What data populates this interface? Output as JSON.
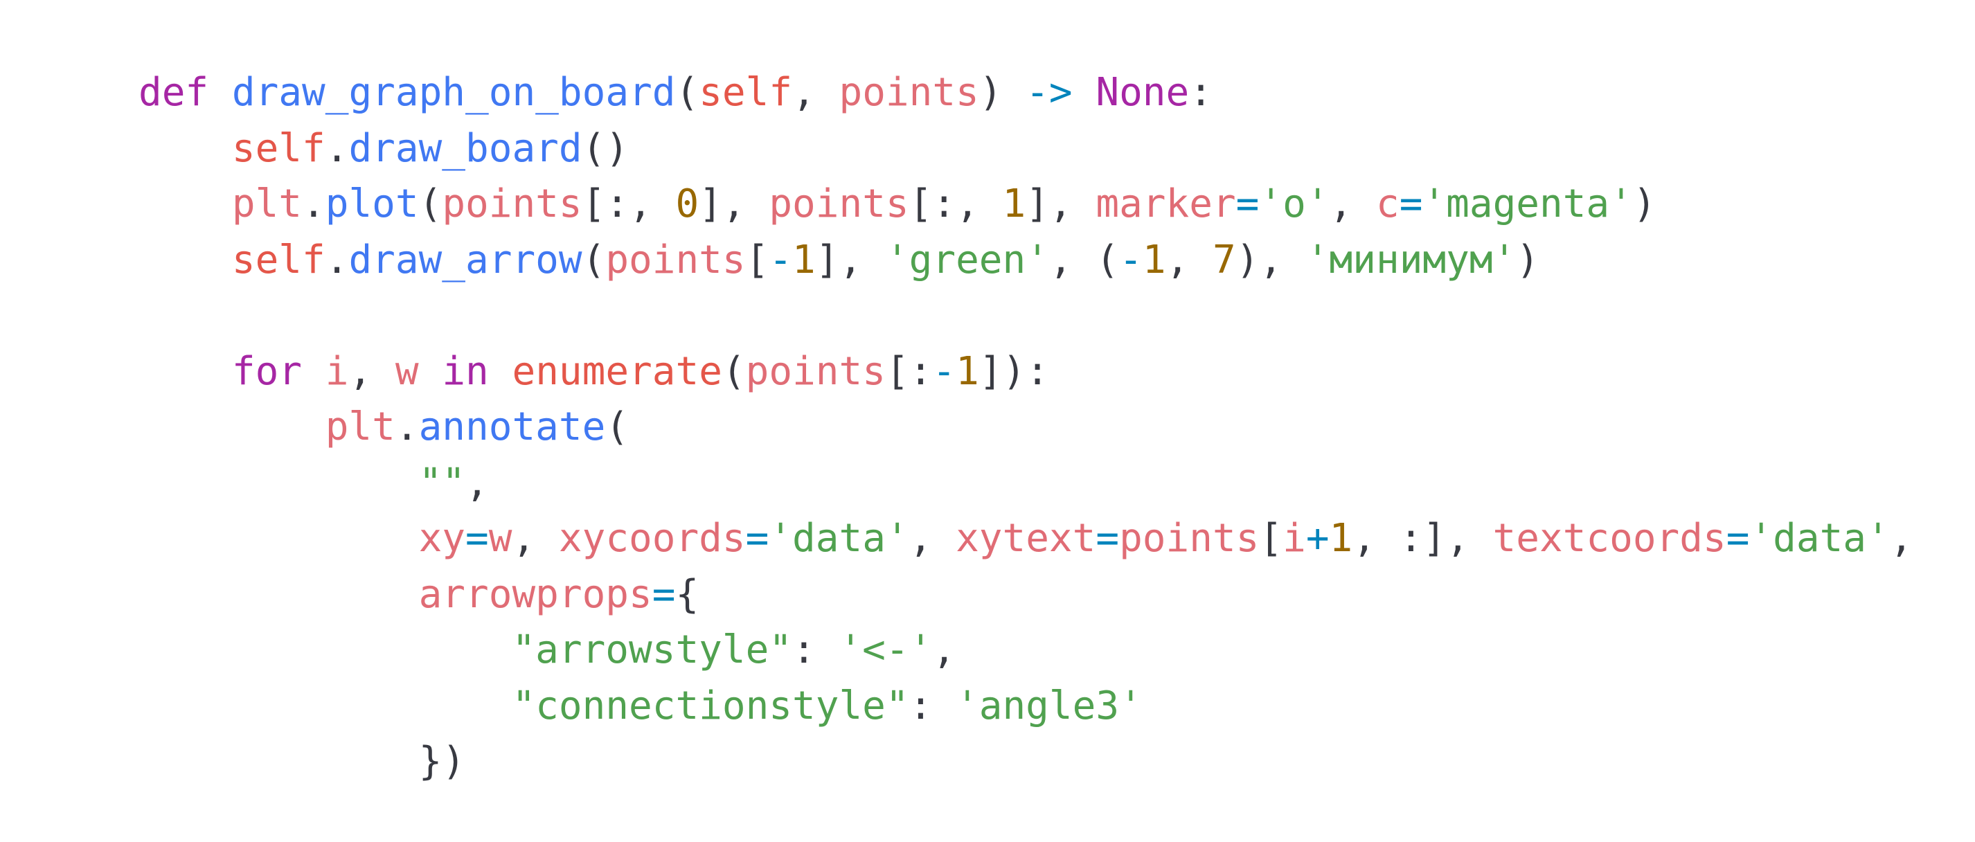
{
  "editor": {
    "language": "python",
    "colors": {
      "background": "#ffffff",
      "keyword": "#a626a4",
      "function": "#4078f2",
      "self": "#e45649",
      "variable": "#e06c75",
      "string": "#50a14f",
      "number": "#986801",
      "operator": "#0184bc",
      "punctuation": "#383a42"
    },
    "lines": [
      {
        "indent": 0,
        "tokens": [
          {
            "t": "def",
            "c": "kw"
          },
          {
            "t": " ",
            "c": "pun"
          },
          {
            "t": "draw_graph_on_board",
            "c": "fn"
          },
          {
            "t": "(",
            "c": "pun"
          },
          {
            "t": "self",
            "c": "self"
          },
          {
            "t": ", ",
            "c": "pun"
          },
          {
            "t": "points",
            "c": "var"
          },
          {
            "t": ") ",
            "c": "pun"
          },
          {
            "t": "->",
            "c": "op"
          },
          {
            "t": " ",
            "c": "pun"
          },
          {
            "t": "None",
            "c": "kw"
          },
          {
            "t": ":",
            "c": "pun"
          }
        ]
      },
      {
        "indent": 1,
        "tokens": [
          {
            "t": "self",
            "c": "self"
          },
          {
            "t": ".",
            "c": "pun"
          },
          {
            "t": "draw_board",
            "c": "fn"
          },
          {
            "t": "()",
            "c": "pun"
          }
        ]
      },
      {
        "indent": 1,
        "tokens": [
          {
            "t": "plt",
            "c": "var"
          },
          {
            "t": ".",
            "c": "pun"
          },
          {
            "t": "plot",
            "c": "fn"
          },
          {
            "t": "(",
            "c": "pun"
          },
          {
            "t": "points",
            "c": "var"
          },
          {
            "t": "[:, ",
            "c": "pun"
          },
          {
            "t": "0",
            "c": "num"
          },
          {
            "t": "], ",
            "c": "pun"
          },
          {
            "t": "points",
            "c": "var"
          },
          {
            "t": "[:, ",
            "c": "pun"
          },
          {
            "t": "1",
            "c": "num"
          },
          {
            "t": "], ",
            "c": "pun"
          },
          {
            "t": "marker",
            "c": "var"
          },
          {
            "t": "=",
            "c": "op"
          },
          {
            "t": "'o'",
            "c": "str"
          },
          {
            "t": ", ",
            "c": "pun"
          },
          {
            "t": "c",
            "c": "var"
          },
          {
            "t": "=",
            "c": "op"
          },
          {
            "t": "'magenta'",
            "c": "str"
          },
          {
            "t": ")",
            "c": "pun"
          }
        ]
      },
      {
        "indent": 1,
        "tokens": [
          {
            "t": "self",
            "c": "self"
          },
          {
            "t": ".",
            "c": "pun"
          },
          {
            "t": "draw_arrow",
            "c": "fn"
          },
          {
            "t": "(",
            "c": "pun"
          },
          {
            "t": "points",
            "c": "var"
          },
          {
            "t": "[",
            "c": "pun"
          },
          {
            "t": "-",
            "c": "op"
          },
          {
            "t": "1",
            "c": "num"
          },
          {
            "t": "], ",
            "c": "pun"
          },
          {
            "t": "'green'",
            "c": "str"
          },
          {
            "t": ", (",
            "c": "pun"
          },
          {
            "t": "-",
            "c": "op"
          },
          {
            "t": "1",
            "c": "num"
          },
          {
            "t": ", ",
            "c": "pun"
          },
          {
            "t": "7",
            "c": "num"
          },
          {
            "t": "), ",
            "c": "pun"
          },
          {
            "t": "'минимум'",
            "c": "str"
          },
          {
            "t": ")",
            "c": "pun"
          }
        ]
      },
      {
        "indent": 0,
        "tokens": []
      },
      {
        "indent": 1,
        "tokens": [
          {
            "t": "for",
            "c": "kw"
          },
          {
            "t": " ",
            "c": "pun"
          },
          {
            "t": "i",
            "c": "var"
          },
          {
            "t": ", ",
            "c": "pun"
          },
          {
            "t": "w",
            "c": "var"
          },
          {
            "t": " ",
            "c": "pun"
          },
          {
            "t": "in",
            "c": "kw"
          },
          {
            "t": " ",
            "c": "pun"
          },
          {
            "t": "enumerate",
            "c": "self"
          },
          {
            "t": "(",
            "c": "pun"
          },
          {
            "t": "points",
            "c": "var"
          },
          {
            "t": "[:",
            "c": "pun"
          },
          {
            "t": "-",
            "c": "op"
          },
          {
            "t": "1",
            "c": "num"
          },
          {
            "t": "]):",
            "c": "pun"
          }
        ]
      },
      {
        "indent": 2,
        "tokens": [
          {
            "t": "plt",
            "c": "var"
          },
          {
            "t": ".",
            "c": "pun"
          },
          {
            "t": "annotate",
            "c": "fn"
          },
          {
            "t": "(",
            "c": "pun"
          }
        ]
      },
      {
        "indent": 3,
        "tokens": [
          {
            "t": "\"\"",
            "c": "str"
          },
          {
            "t": ",",
            "c": "pun"
          }
        ]
      },
      {
        "indent": 3,
        "tokens": [
          {
            "t": "xy",
            "c": "var"
          },
          {
            "t": "=",
            "c": "op"
          },
          {
            "t": "w",
            "c": "var"
          },
          {
            "t": ", ",
            "c": "pun"
          },
          {
            "t": "xycoords",
            "c": "var"
          },
          {
            "t": "=",
            "c": "op"
          },
          {
            "t": "'data'",
            "c": "str"
          },
          {
            "t": ", ",
            "c": "pun"
          },
          {
            "t": "xytext",
            "c": "var"
          },
          {
            "t": "=",
            "c": "op"
          },
          {
            "t": "points",
            "c": "var"
          },
          {
            "t": "[",
            "c": "pun"
          },
          {
            "t": "i",
            "c": "var"
          },
          {
            "t": "+",
            "c": "op"
          },
          {
            "t": "1",
            "c": "num"
          },
          {
            "t": ", :], ",
            "c": "pun"
          },
          {
            "t": "textcoords",
            "c": "var"
          },
          {
            "t": "=",
            "c": "op"
          },
          {
            "t": "'data'",
            "c": "str"
          },
          {
            "t": ",",
            "c": "pun"
          }
        ]
      },
      {
        "indent": 3,
        "tokens": [
          {
            "t": "arrowprops",
            "c": "var"
          },
          {
            "t": "=",
            "c": "op"
          },
          {
            "t": "{",
            "c": "pun"
          }
        ]
      },
      {
        "indent": 4,
        "tokens": [
          {
            "t": "\"arrowstyle\"",
            "c": "str"
          },
          {
            "t": ": ",
            "c": "pun"
          },
          {
            "t": "'<-'",
            "c": "str"
          },
          {
            "t": ",",
            "c": "pun"
          }
        ]
      },
      {
        "indent": 4,
        "tokens": [
          {
            "t": "\"connectionstyle\"",
            "c": "str"
          },
          {
            "t": ": ",
            "c": "pun"
          },
          {
            "t": "'angle3'",
            "c": "str"
          }
        ]
      },
      {
        "indent": 3,
        "tokens": [
          {
            "t": "})",
            "c": "pun"
          }
        ]
      }
    ]
  }
}
